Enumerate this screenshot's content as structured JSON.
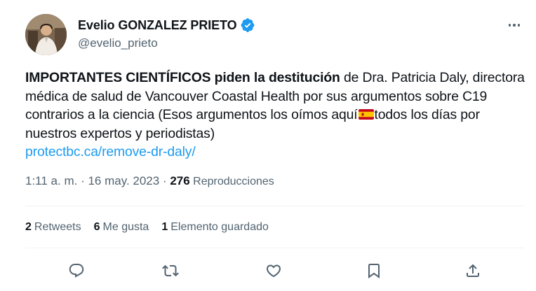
{
  "author": {
    "name": "Evelio GONZALEZ PRIETO",
    "handle": "@evelio_prieto",
    "avatar_icon": "user-avatar-photo",
    "verified_icon": "verified-badge-icon",
    "verified_color": "#1d9bf0"
  },
  "tweet": {
    "bold_text": "IMPORTANTES CIENTÍFICOS piden la destitución",
    "text_part1": " de Dra. Patricia Daly, directora médica de salud de Vancouver Coastal Health por sus argumentos sobre C19 contrarios a la ciencia (Esos argumentos los oímos aquí",
    "flag_icon": "spain-flag-icon",
    "text_part2": "todos los días por nuestros expertos y periodistas)",
    "link": "protectbc.ca/remove-dr-daly/",
    "link_color": "#1d9bf0"
  },
  "meta": {
    "time": "1:11 a. m.",
    "sep1": " · ",
    "date": "16 may. 2023",
    "sep2": " · ",
    "views_count": "276",
    "views_label": " Reproducciones"
  },
  "stats": {
    "retweets_count": "2",
    "retweets_label": "Retweets",
    "likes_count": "6",
    "likes_label": "Me gusta",
    "bookmarks_count": "1",
    "bookmarks_label": "Elemento guardado"
  },
  "actions": [
    "reply-icon",
    "retweet-icon",
    "like-icon",
    "bookmark-icon",
    "share-icon"
  ],
  "colors": {
    "text": "#0f1419",
    "secondary": "#536471",
    "divider": "#eff3f4"
  }
}
